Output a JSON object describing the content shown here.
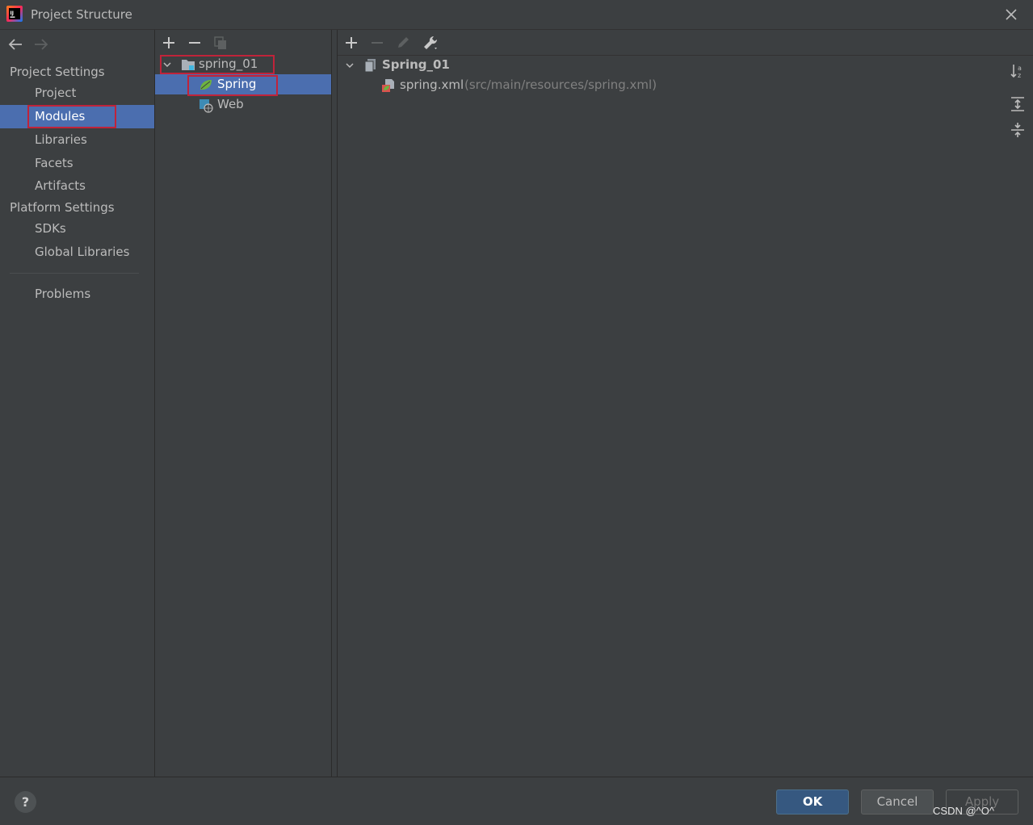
{
  "window": {
    "title": "Project Structure"
  },
  "nav": {
    "project_settings_label": "Project Settings",
    "project_settings_items": [
      "Project",
      "Modules",
      "Libraries",
      "Facets",
      "Artifacts"
    ],
    "platform_settings_label": "Platform Settings",
    "platform_settings_items": [
      "SDKs",
      "Global Libraries"
    ],
    "problems_label": "Problems",
    "selected": "Modules"
  },
  "module_tree": {
    "root": "spring_01",
    "children": [
      "Spring",
      "Web"
    ],
    "selected": "Spring"
  },
  "detail": {
    "group_label": "Spring_01",
    "file_name": "spring.xml",
    "file_path": "(src/main/resources/spring.xml)"
  },
  "footer": {
    "help_label": "?",
    "ok_label": "OK",
    "cancel_label": "Cancel",
    "apply_label": "Apply"
  },
  "watermark": "CSDN @^O^",
  "colors": {
    "background": "#3c3f41",
    "selection": "#4b6eaf",
    "highlight_box": "#c0233a",
    "primary_button": "#365880"
  }
}
